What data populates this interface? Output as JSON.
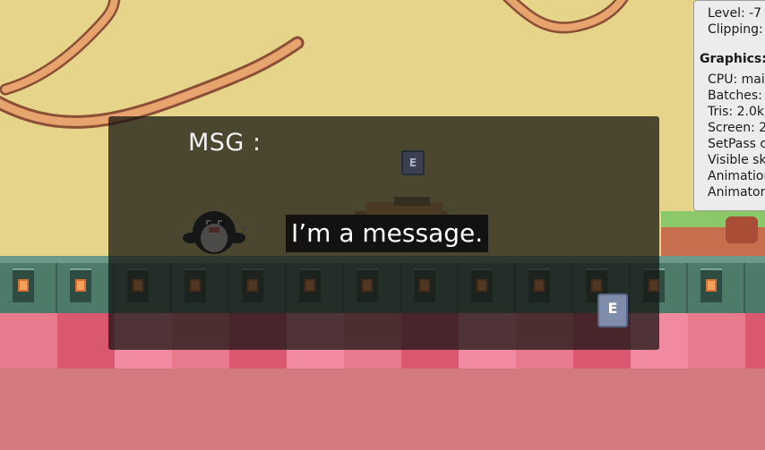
{
  "stats_panel": {
    "lines": [
      "Level: -7",
      "Clipping:"
    ],
    "graphics_title": "Graphics:",
    "graphics_lines": [
      "CPU: mai",
      "Batches:",
      "Tris: 2.0k",
      "Screen: 2",
      "SetPass c",
      "Visible sk",
      "Animation",
      "Animator"
    ]
  },
  "message_box": {
    "label": "MSG :",
    "text": "I’m a message."
  },
  "prompts": {
    "interact_key": "E"
  },
  "colors": {
    "sky": "#e5d489",
    "rope": "#c98a5a",
    "tile": "#4e7a6a",
    "pink_band": "#e97a8d",
    "ground": "#d27a7f",
    "overlay": "#161412",
    "key_cap": "#7f8cab"
  },
  "icons": [
    "key-e-icon",
    "penguin-sprite",
    "wagon-sprite",
    "rope-decoration"
  ]
}
